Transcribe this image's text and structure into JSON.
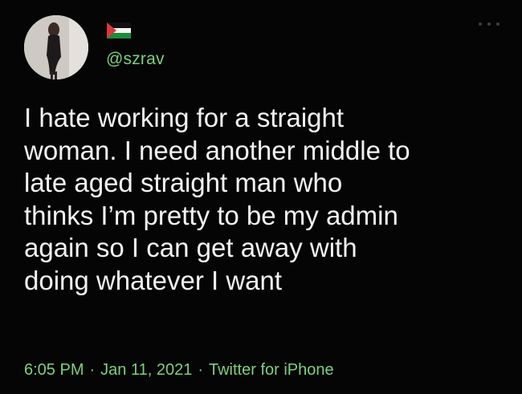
{
  "colors": {
    "background": "#050505",
    "text": "#f2f2f2",
    "accent_green": "#7ecf7e"
  },
  "author": {
    "display_name_icon": "palestine-flag-icon",
    "handle": "@szrav"
  },
  "tweet": {
    "lines": [
      "I hate working for a straight",
      "woman. I need another middle to",
      "late aged straight man who",
      "thinks I’m pretty to be my admin",
      "again so I can get away with",
      "doing whatever I want"
    ],
    "time": "6:05 PM",
    "separator": "·",
    "date": "Jan 11, 2021",
    "source": "Twitter for iPhone"
  },
  "menu_icon": "more-options-icon"
}
